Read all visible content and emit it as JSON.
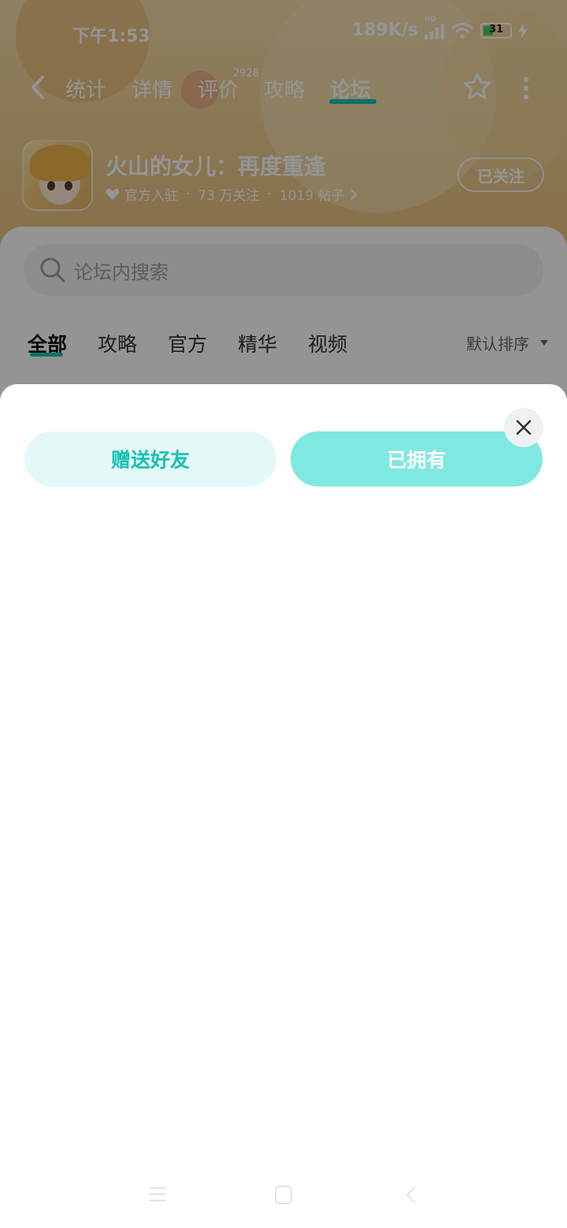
{
  "status_bar": {
    "time": "下午1:53",
    "network_speed": "189K/s",
    "signal_badge": "HD",
    "battery_level": "31"
  },
  "nav": {
    "tabs": [
      {
        "label": "统计"
      },
      {
        "label": "详情"
      },
      {
        "label": "评价",
        "badge": "2928"
      },
      {
        "label": "攻略"
      },
      {
        "label": "论坛",
        "active": true
      }
    ],
    "icons": [
      "back-icon",
      "star-icon",
      "more-icon"
    ]
  },
  "game": {
    "title": "火山的女儿：再度重逢",
    "official": "官方入驻",
    "followers": "73 万关注",
    "posts": "1019 帖子",
    "follow_button": "已关注"
  },
  "forum": {
    "search_placeholder": "论坛内搜索",
    "tabs": [
      {
        "label": "全部",
        "active": true
      },
      {
        "label": "攻略"
      },
      {
        "label": "官方"
      },
      {
        "label": "精华"
      },
      {
        "label": "视频"
      }
    ],
    "sort_label": "默认排序"
  },
  "sheet": {
    "gift_button": "赠送好友",
    "owned_button": "已拥有"
  },
  "colors": {
    "accent": "#19c3b3",
    "owned_button_bg": "#7fe8e0",
    "gift_button_bg": "#e4f8f8"
  }
}
